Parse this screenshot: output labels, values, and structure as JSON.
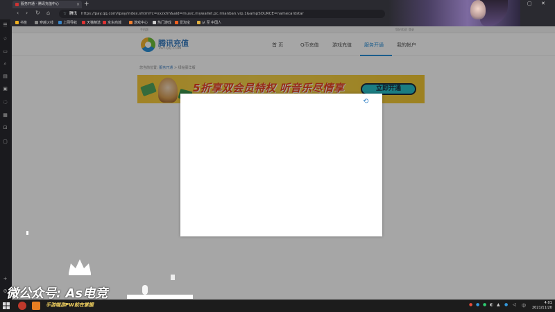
{
  "browser": {
    "tab_title": "服务开通 - 腾讯充值中心",
    "new_tab": "+",
    "url_site": "腾讯",
    "url": "https://pay.qq.com/ipay/index.shtml?c=xxzxhh&aid=music.mywallet.pc.mianban.vip.1&ampSOURCE=namecardstar",
    "controls": [
      "—",
      "▢",
      "✕"
    ],
    "bookmarks": [
      {
        "label": "书签",
        "color": "#f0b020"
      },
      {
        "label": "穿越火线",
        "color": "#888"
      },
      {
        "label": "上网导航",
        "color": "#3a86c8"
      },
      {
        "label": "天猫精选",
        "color": "#d33"
      },
      {
        "label": "京东商城",
        "color": "#d33"
      },
      {
        "label": "游戏中心",
        "color": "#f08030"
      },
      {
        "label": "热门游戏",
        "color": "#ccc"
      },
      {
        "label": "爱淘宝",
        "color": "#f06020"
      },
      {
        "label": "从 至 中国人",
        "color": "#e0b040"
      }
    ]
  },
  "page": {
    "top_left": "手机版",
    "top_right": "您好欢迎! 登录",
    "logo_name": "腾讯充值",
    "logo_sub": "PAY.QQ.COM",
    "nav": [
      "首 页",
      "Q币充值",
      "游戏充值",
      "服务开通",
      "我的帐户"
    ],
    "active_nav": "服务开通",
    "breadcrumb_prefix": "您当前位置:",
    "breadcrumb_link": "服务开通",
    "breadcrumb_current": "> 绿钻豪华版",
    "promo_headline": "5折享双会员特权 听音乐尽情享",
    "promo_cta": "立即开通"
  },
  "modal": {
    "loading_icon": "loading-icon"
  },
  "watermark": {
    "text": "微公众号: As电竞"
  },
  "taskbar": {
    "ticker": "手游端游PW就在掌握",
    "time": "4:01",
    "date": "2021/11/20"
  }
}
